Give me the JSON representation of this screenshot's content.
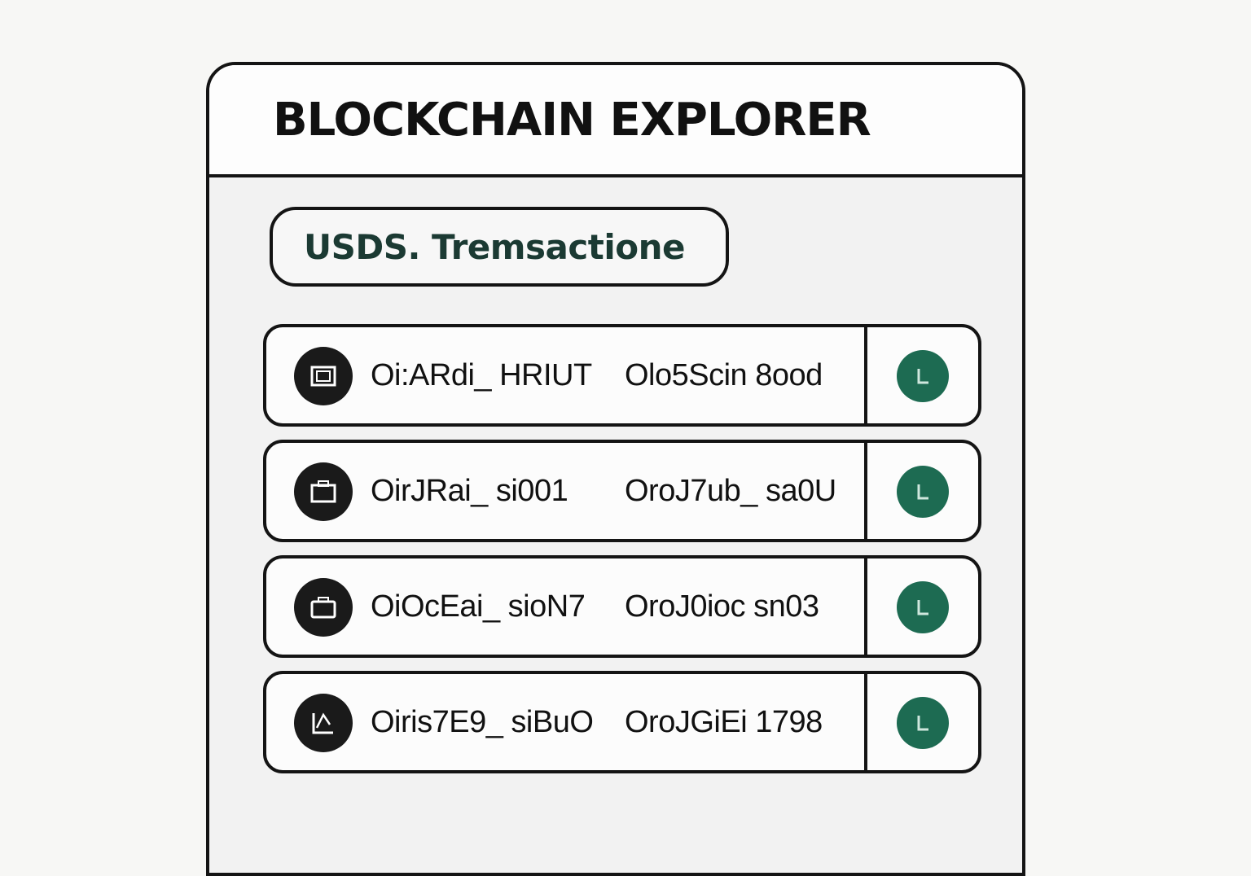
{
  "app": {
    "title": "BLOCKCHAIN EXPLORER"
  },
  "filter": {
    "label": "USDS. Tremsactione"
  },
  "colors": {
    "status_ok": "#1d6b52",
    "border": "#141414",
    "panel_bg": "#f2f2f2"
  },
  "transactions": [
    {
      "icon": "wallet-icon",
      "hash": "Oi:ARdi_ HRIUT",
      "address": "Olo5Scin 8ood",
      "status_icon": "confirmed-icon"
    },
    {
      "icon": "wallet-icon",
      "hash": "OirJRai_ si001",
      "address": "OroJ7ub_ sa0U",
      "status_icon": "confirmed-icon"
    },
    {
      "icon": "briefcase-icon",
      "hash": "OiOcEai_ sioN7",
      "address": "OroJ0ioc sn03",
      "status_icon": "confirmed-icon"
    },
    {
      "icon": "exchange-icon",
      "hash": "Oiris7E9_ siBuO",
      "address": "OroJGiEi 1798",
      "status_icon": "confirmed-icon"
    }
  ]
}
